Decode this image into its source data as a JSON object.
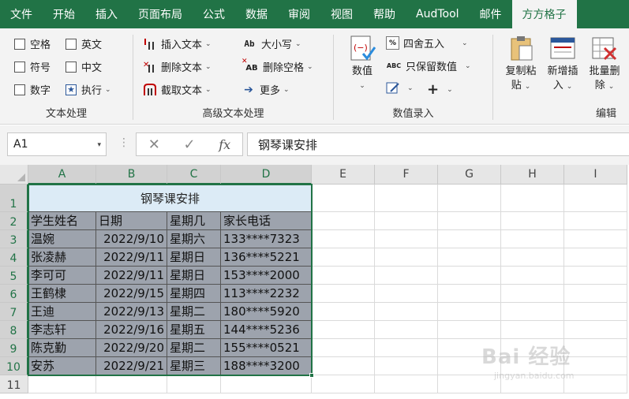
{
  "menu": {
    "tabs": [
      "文件",
      "开始",
      "插入",
      "页面布局",
      "公式",
      "数据",
      "审阅",
      "视图",
      "帮助",
      "AudTool",
      "邮件",
      "方方格子"
    ],
    "active": "方方格子"
  },
  "ribbon": {
    "text_group": {
      "label": "文本处理",
      "items": [
        "空格",
        "英文",
        "符号",
        "中文",
        "数字",
        "执行"
      ]
    },
    "adv_text_group": {
      "label": "高级文本处理",
      "items": [
        "插入文本",
        "删除文本",
        "截取文本",
        "大小写",
        "删除空格",
        "更多"
      ],
      "icons": {
        "case": "Ab",
        "space": "AB"
      }
    },
    "num_group": {
      "label": "数值录入",
      "big_button": "数值",
      "items": [
        "四舍五入",
        "只保留数值"
      ],
      "icons": {
        "round": "%",
        "keep": "ABC"
      },
      "plus": "+"
    },
    "edit_group": {
      "label": "编辑",
      "buttons": [
        {
          "line1": "复制粘",
          "line2": "贴"
        },
        {
          "line1": "新增插",
          "line2": "入"
        },
        {
          "line1": "批量删",
          "line2": "除"
        }
      ]
    }
  },
  "formula_bar": {
    "name_box": "A1",
    "formula": "钢琴课安排",
    "cancel_glyph": "✕",
    "enter_glyph": "✓",
    "fx_glyph": "fx"
  },
  "sheet": {
    "columns": [
      "A",
      "B",
      "C",
      "D",
      "E",
      "F",
      "G",
      "H",
      "I"
    ],
    "rows": [
      "1",
      "2",
      "3",
      "4",
      "5",
      "6",
      "7",
      "8",
      "9",
      "10",
      "11"
    ],
    "title": "钢琴课安排",
    "headers": [
      "学生姓名",
      "日期",
      "星期几",
      "家长电话"
    ],
    "records": [
      [
        "温婉",
        "2022/9/10",
        "星期六",
        "133****7323"
      ],
      [
        "张凌赫",
        "2022/9/11",
        "星期日",
        "136****5221"
      ],
      [
        "李可可",
        "2022/9/11",
        "星期日",
        "153****2000"
      ],
      [
        "王鹤棣",
        "2022/9/15",
        "星期四",
        "113****2232"
      ],
      [
        "王迪",
        "2022/9/13",
        "星期二",
        "180****5920"
      ],
      [
        "李志轩",
        "2022/9/16",
        "星期五",
        "144****5236"
      ],
      [
        "陈克勤",
        "2022/9/20",
        "星期二",
        "155****0521"
      ],
      [
        "安苏",
        "2022/9/21",
        "星期三",
        "188****3200"
      ]
    ]
  },
  "watermark": {
    "line1": "Bai 经验",
    "line2": "jingyan.baidu.com"
  },
  "colors": {
    "accent": "#217346",
    "selection_fill": "#9da3ad",
    "title_fill": "#dcebf6"
  }
}
